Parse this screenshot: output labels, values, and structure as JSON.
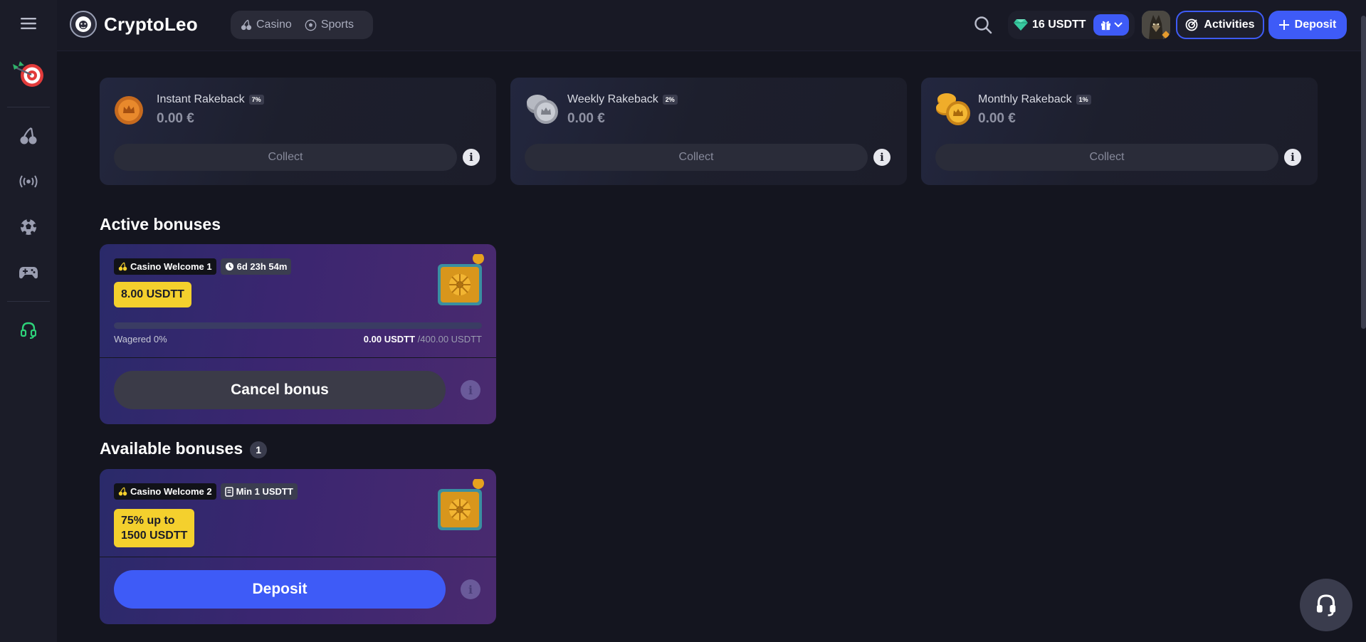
{
  "app": {
    "name": "CryptoLeo"
  },
  "nav": {
    "casino_label": "Casino",
    "sports_label": "Sports"
  },
  "header": {
    "balance": "16 USDTT",
    "activities_label": "Activities",
    "deposit_label": "Deposit"
  },
  "sidebar": {
    "items": [
      "menu-icon",
      "darts-promo-icon",
      "cherry-casino-icon",
      "live-broadcast-icon",
      "football-sports-icon",
      "gamepad-icon",
      "support-headset-icon"
    ]
  },
  "rakeback": [
    {
      "title": "Instant Rakeback",
      "percent": "7%",
      "amount": "0.00 €",
      "collect_label": "Collect",
      "info": "i"
    },
    {
      "title": "Weekly Rakeback",
      "percent": "2%",
      "amount": "0.00 €",
      "collect_label": "Collect",
      "info": "i"
    },
    {
      "title": "Monthly Rakeback",
      "percent": "1%",
      "amount": "0.00 €",
      "collect_label": "Collect",
      "info": "i"
    }
  ],
  "active_bonuses": {
    "title": "Active bonuses",
    "card": {
      "name": "Casino Welcome 1",
      "timer": "6d 23h 54m",
      "amount": "8.00 USDTT",
      "wagered_label": "Wagered 0%",
      "wagered_progress": 0,
      "wagered_current": "0.00 USDTT",
      "wagered_total": "/400.00 USDTT",
      "cancel_label": "Cancel bonus",
      "info": "i"
    }
  },
  "available_bonuses": {
    "title": "Available bonuses",
    "count": "1",
    "card": {
      "name": "Casino Welcome 2",
      "min_label": "Min 1 USDTT",
      "offer_line1": "75% up to",
      "offer_line2": "1500 USDTT",
      "deposit_label": "Deposit",
      "info": "i"
    }
  },
  "colors": {
    "accent_blue": "#3e5bf7",
    "bonus_yellow": "#f4d02d",
    "background": "#14151f",
    "support_green": "#2ed37a"
  }
}
